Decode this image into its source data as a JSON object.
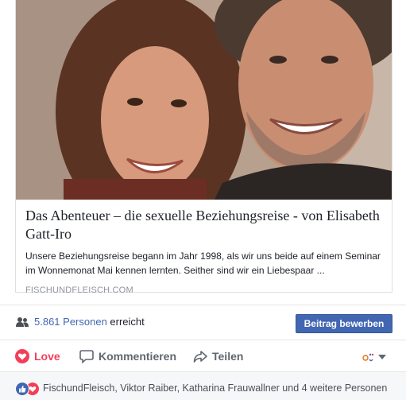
{
  "link_card": {
    "title": "Das Abenteuer – die sexuelle Beziehungsreise - von Elisabeth Gatt-Iro",
    "description": "Unsere Beziehungsreise begann im Jahr 1998, als wir uns beide auf einem Seminar im Wonnemonat Mai kennen lernten. Seither sind wir ein Liebespaar ...",
    "domain": "FISCHUNDFLEISCH.COM"
  },
  "reach": {
    "count_label": "5.861 Personen",
    "suffix": "erreicht",
    "boost_label": "Beitrag bewerben"
  },
  "actions": {
    "love_label": "Love",
    "comment_label": "Kommentieren",
    "share_label": "Teilen"
  },
  "reactions": {
    "names_label": "FischundFleisch, Viktor Raiber, Katharina Frauwallner und 4 weitere Personen",
    "icons": [
      "like-icon",
      "love-icon"
    ]
  },
  "colors": {
    "accent": "#4267b2",
    "love": "#f33e58",
    "muted": "#616770"
  }
}
